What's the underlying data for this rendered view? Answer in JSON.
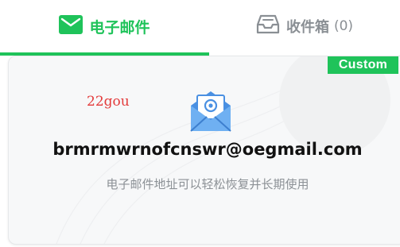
{
  "tabs": {
    "email": {
      "label": "电子邮件",
      "icon": "envelope-icon"
    },
    "inbox": {
      "label": "收件箱",
      "count": "(0)",
      "icon": "inbox-tray-icon"
    }
  },
  "card": {
    "badge": "Custom",
    "user_tag": "22gou",
    "email_address": "brmrmwrnofcnswr@oegmail.com",
    "subtitle": "电子邮件地址可以轻松恢复并长期使用"
  },
  "colors": {
    "accent": "#1fc35a",
    "muted": "#8a8f94",
    "tag_red": "#e33b3b",
    "icon_blue": "#4a90e2"
  }
}
